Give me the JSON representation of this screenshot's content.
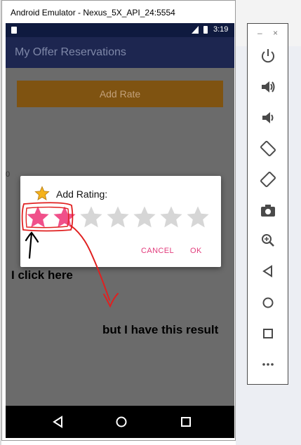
{
  "window": {
    "title": "Android Emulator - Nexus_5X_API_24:5554"
  },
  "status_bar": {
    "time": "3:19"
  },
  "app": {
    "title": "My Offer Reservations",
    "add_rate_label": "Add Rate",
    "stray_text": "0"
  },
  "dialog": {
    "title": "Add Rating:",
    "rating": {
      "filled": 2,
      "total": 7,
      "fill_color": "#f0508a",
      "empty_color": "#d6d6d6"
    },
    "cancel_label": "CANCEL",
    "ok_label": "OK",
    "accent_color": "#e23c7c"
  },
  "nav": {
    "icons": [
      "back-icon",
      "home-icon",
      "recents-icon"
    ]
  },
  "controls": {
    "min_label": "–",
    "close_label": "×",
    "icons": [
      "power-icon",
      "volume-up-icon",
      "volume-down-icon",
      "rotate-left-icon",
      "rotate-right-icon",
      "camera-icon",
      "zoom-icon",
      "back-icon",
      "home-icon",
      "overview-icon",
      "more-icon"
    ]
  },
  "annotations": {
    "note1": "I click here",
    "note2": "but I have this result",
    "color": "#e02020"
  }
}
